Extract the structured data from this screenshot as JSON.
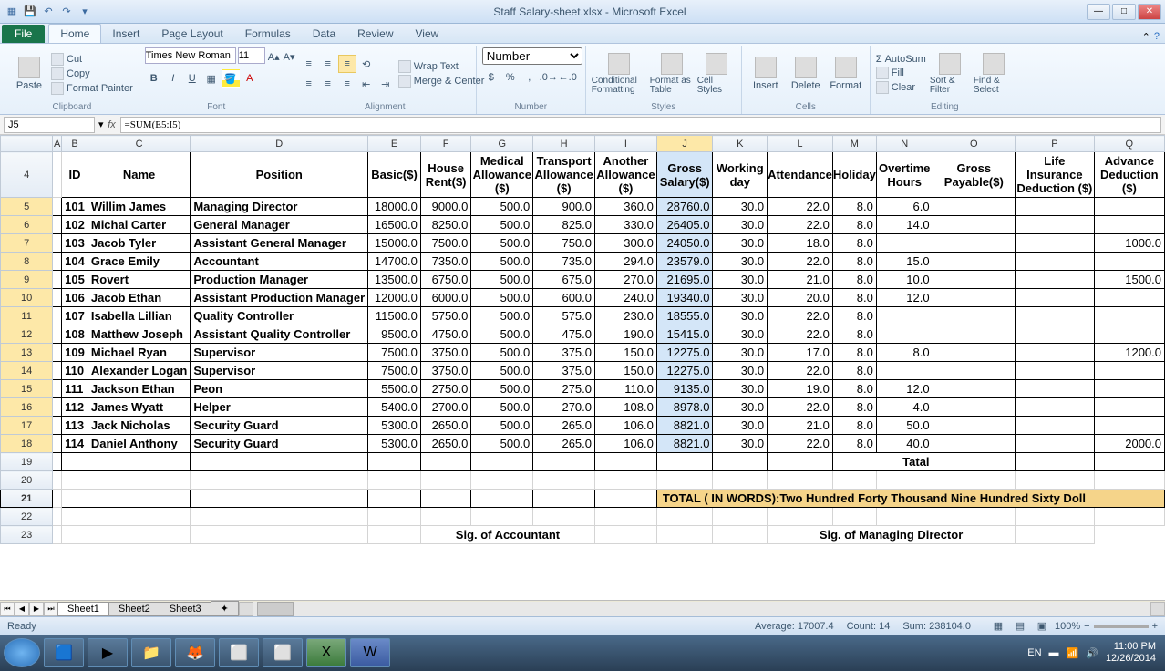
{
  "window": {
    "title": "Staff  Salary-sheet.xlsx - Microsoft Excel"
  },
  "tabs": {
    "file": "File",
    "list": [
      "Home",
      "Insert",
      "Page Layout",
      "Formulas",
      "Data",
      "Review",
      "View"
    ],
    "active": 0
  },
  "ribbon": {
    "clipboard": {
      "label": "Clipboard",
      "paste": "Paste",
      "cut": "Cut",
      "copy": "Copy",
      "fmtpainter": "Format Painter"
    },
    "font": {
      "label": "Font",
      "name": "Times New Roman",
      "size": "11"
    },
    "alignment": {
      "label": "Alignment",
      "wrap": "Wrap Text",
      "merge": "Merge & Center"
    },
    "number": {
      "label": "Number",
      "format": "Number"
    },
    "styles": {
      "label": "Styles",
      "cond": "Conditional Formatting",
      "table": "Format as Table",
      "cell": "Cell Styles"
    },
    "cells": {
      "label": "Cells",
      "insert": "Insert",
      "delete": "Delete",
      "format": "Format"
    },
    "editing": {
      "label": "Editing",
      "autosum": "AutoSum",
      "fill": "Fill",
      "clear": "Clear",
      "sort": "Sort & Filter",
      "find": "Find & Select"
    }
  },
  "namebox": "J5",
  "formula": "=SUM(E5:I5)",
  "columns": [
    "A",
    "B",
    "C",
    "D",
    "E",
    "F",
    "G",
    "H",
    "I",
    "J",
    "K",
    "L",
    "M",
    "N",
    "O",
    "P",
    "Q"
  ],
  "sel_col": "J",
  "headers": {
    "id": "ID",
    "name": "Name",
    "position": "Position",
    "basic": "Basic($)",
    "house": "House Rent($)",
    "medical": "Medical Allowance ($)",
    "transport": "Transport Allowance ($)",
    "another": "Another Allowance ($)",
    "gross_sal": "Gross Salary($)",
    "workday": "Working day",
    "attendance": "Attendance",
    "holiday": "Holiday",
    "ot": "Overtime Hours",
    "gross_pay": "Gross Payable($)",
    "life": "Life Insurance Deduction ($)",
    "advance": "Advance Deduction ($)",
    "d": "D"
  },
  "chart_data": {
    "type": "table",
    "columns": [
      "row",
      "ID",
      "Name",
      "Position",
      "Basic",
      "House Rent",
      "Medical",
      "Transport",
      "Another",
      "Gross Salary",
      "Working day",
      "Attendance",
      "Holiday",
      "Overtime",
      "Gross Payable",
      "Life Ins",
      "Advance"
    ],
    "rows": [
      [
        5,
        "101",
        "Willim James",
        "Managing Director",
        "18000.0",
        "9000.0",
        "500.0",
        "900.0",
        "360.0",
        "28760.0",
        "30.0",
        "22.0",
        "8.0",
        "6.0",
        "",
        "",
        ""
      ],
      [
        6,
        "102",
        "Michal Carter",
        "General Manager",
        "16500.0",
        "8250.0",
        "500.0",
        "825.0",
        "330.0",
        "26405.0",
        "30.0",
        "22.0",
        "8.0",
        "14.0",
        "",
        "",
        ""
      ],
      [
        7,
        "103",
        "Jacob Tyler",
        "Assistant General Manager",
        "15000.0",
        "7500.0",
        "500.0",
        "750.0",
        "300.0",
        "24050.0",
        "30.0",
        "18.0",
        "8.0",
        "",
        "",
        "",
        "1000.0"
      ],
      [
        8,
        "104",
        "Grace Emily",
        "Accountant",
        "14700.0",
        "7350.0",
        "500.0",
        "735.0",
        "294.0",
        "23579.0",
        "30.0",
        "22.0",
        "8.0",
        "15.0",
        "",
        "",
        ""
      ],
      [
        9,
        "105",
        "Rovert",
        "Production Manager",
        "13500.0",
        "6750.0",
        "500.0",
        "675.0",
        "270.0",
        "21695.0",
        "30.0",
        "21.0",
        "8.0",
        "10.0",
        "",
        "",
        "1500.0"
      ],
      [
        10,
        "106",
        "Jacob Ethan",
        "Assistant Production Manager",
        "12000.0",
        "6000.0",
        "500.0",
        "600.0",
        "240.0",
        "19340.0",
        "30.0",
        "20.0",
        "8.0",
        "12.0",
        "",
        "",
        ""
      ],
      [
        11,
        "107",
        "Isabella Lillian",
        "Quality Controller",
        "11500.0",
        "5750.0",
        "500.0",
        "575.0",
        "230.0",
        "18555.0",
        "30.0",
        "22.0",
        "8.0",
        "",
        "",
        "",
        ""
      ],
      [
        12,
        "108",
        "Matthew Joseph",
        "Assistant Quality Controller",
        "9500.0",
        "4750.0",
        "500.0",
        "475.0",
        "190.0",
        "15415.0",
        "30.0",
        "22.0",
        "8.0",
        "",
        "",
        "",
        ""
      ],
      [
        13,
        "109",
        "Michael Ryan",
        "Supervisor",
        "7500.0",
        "3750.0",
        "500.0",
        "375.0",
        "150.0",
        "12275.0",
        "30.0",
        "17.0",
        "8.0",
        "8.0",
        "",
        "",
        "1200.0"
      ],
      [
        14,
        "110",
        "Alexander Logan",
        "Supervisor",
        "7500.0",
        "3750.0",
        "500.0",
        "375.0",
        "150.0",
        "12275.0",
        "30.0",
        "22.0",
        "8.0",
        "",
        "",
        "",
        ""
      ],
      [
        15,
        "111",
        "Jackson Ethan",
        "Peon",
        "5500.0",
        "2750.0",
        "500.0",
        "275.0",
        "110.0",
        "9135.0",
        "30.0",
        "19.0",
        "8.0",
        "12.0",
        "",
        "",
        ""
      ],
      [
        16,
        "112",
        "James Wyatt",
        "Helper",
        "5400.0",
        "2700.0",
        "500.0",
        "270.0",
        "108.0",
        "8978.0",
        "30.0",
        "22.0",
        "8.0",
        "4.0",
        "",
        "",
        ""
      ],
      [
        17,
        "113",
        "Jack Nicholas",
        "Security Guard",
        "5300.0",
        "2650.0",
        "500.0",
        "265.0",
        "106.0",
        "8821.0",
        "30.0",
        "21.0",
        "8.0",
        "50.0",
        "",
        "",
        ""
      ],
      [
        18,
        "114",
        "Daniel Anthony",
        "Security Guard",
        "5300.0",
        "2650.0",
        "500.0",
        "265.0",
        "106.0",
        "8821.0",
        "30.0",
        "22.0",
        "8.0",
        "40.0",
        "",
        "",
        "2000.0"
      ]
    ]
  },
  "total_label": "Tatal",
  "inwords": "TOTAL ( IN WORDS):Two Hundred Forty Thousand Nine Hundred Sixty  Doll",
  "sig1": "Sig. of Accountant",
  "sig2": "Sig. of Managing Director",
  "sheets": [
    "Sheet1",
    "Sheet2",
    "Sheet3"
  ],
  "status": {
    "ready": "Ready",
    "avg_lbl": "Average:",
    "avg": "17007.4",
    "cnt_lbl": "Count:",
    "cnt": "14",
    "sum_lbl": "Sum:",
    "sum": "238104.0",
    "zoom": "100%"
  },
  "tray": {
    "lang": "EN",
    "time": "11:00 PM",
    "date": "12/26/2014"
  }
}
